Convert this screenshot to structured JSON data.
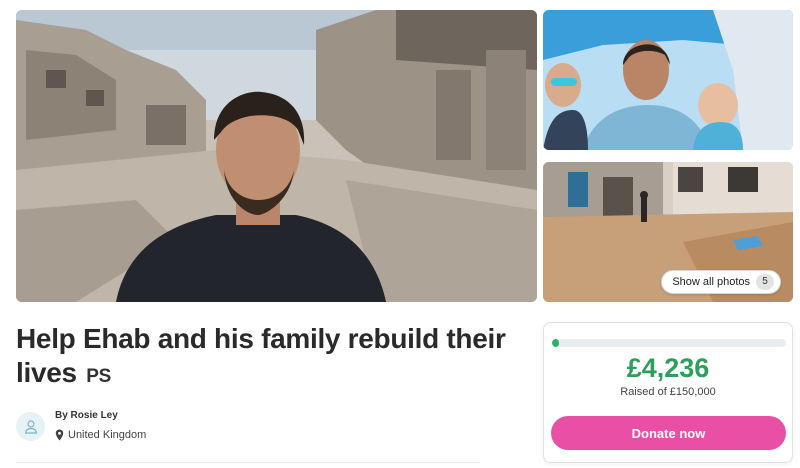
{
  "campaign": {
    "title": "Help Ehab and his family rebuild their lives",
    "country_tag": "PS"
  },
  "gallery": {
    "hero_photo": "man-selfie-in-destroyed-street",
    "thumb_1_photo": "man-with-two-children",
    "thumb_2_photo": "damaged-buildings-dirt-yard",
    "show_all_label": "Show all photos",
    "photo_count": "5"
  },
  "organizer": {
    "name": "By Rosie Ley",
    "location": "United Kingdom"
  },
  "donation": {
    "raised": "£4,236",
    "goal_text": "Raised of £150,000",
    "progress_fraction": 0.028,
    "donate_label": "Donate now"
  },
  "colors": {
    "accent_green": "#2e9e5b",
    "donate_pink": "#e94fa4",
    "progress_track": "#e9ecef"
  }
}
